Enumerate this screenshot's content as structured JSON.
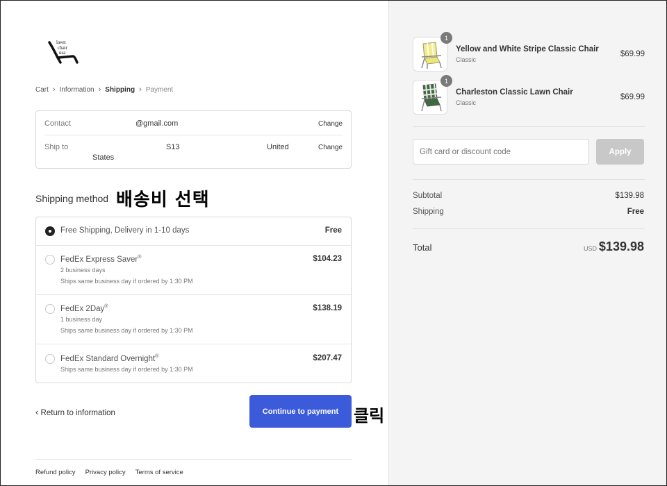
{
  "brand": {
    "logo_lines": [
      "lawn",
      "chair",
      "usa"
    ]
  },
  "breadcrumb": [
    "Cart",
    "Information",
    "Shipping",
    "Payment"
  ],
  "review": {
    "contact_label": "Contact",
    "contact_value": "@gmail.com",
    "shipto_label": "Ship to",
    "shipto_part1": "S13",
    "shipto_part2": "United",
    "shipto_part3": "States",
    "change_label": "Change"
  },
  "shipping": {
    "title": "Shipping method",
    "annotation": "배송비 선택",
    "methods": [
      {
        "name": "Free Shipping, Delivery in 1-10 days",
        "reg": "",
        "sub1": "",
        "sub2": "",
        "price": "Free",
        "selected": true
      },
      {
        "name": "FedEx Express Saver",
        "reg": "®",
        "sub1": "2 business days",
        "sub2": "Ships same business day if ordered by 1:30 PM",
        "price": "$104.23",
        "selected": false
      },
      {
        "name": "FedEx 2Day",
        "reg": "®",
        "sub1": "1 business day",
        "sub2": "Ships same business day if ordered by 1:30 PM",
        "price": "$138.19",
        "selected": false
      },
      {
        "name": "FedEx Standard Overnight",
        "reg": "®",
        "sub1": "Ships same business day if ordered by 1:30 PM",
        "sub2": "",
        "price": "$207.47",
        "selected": false
      }
    ]
  },
  "nav": {
    "back_label": "Return to information",
    "continue_label": "Continue to payment",
    "continue_annotation": "클릭"
  },
  "footer": [
    "Refund policy",
    "Privacy policy",
    "Terms of service"
  ],
  "cart": {
    "items": [
      {
        "qty": "1",
        "name": "Yellow and White Stripe Classic Chair",
        "variant": "Classic",
        "price": "$69.99"
      },
      {
        "qty": "1",
        "name": "Charleston Classic Lawn Chair",
        "variant": "Classic",
        "price": "$69.99"
      }
    ],
    "discount_placeholder": "Gift card or discount code",
    "apply_label": "Apply",
    "subtotal_label": "Subtotal",
    "subtotal_value": "$139.98",
    "shipping_label": "Shipping",
    "shipping_value": "Free",
    "total_label": "Total",
    "currency": "USD",
    "total_value": "$139.98"
  },
  "colors": {
    "primary_button": "#3b5bdb",
    "sidebar_bg": "#f4f4f4",
    "apply_disabled": "#c8c8c8"
  }
}
